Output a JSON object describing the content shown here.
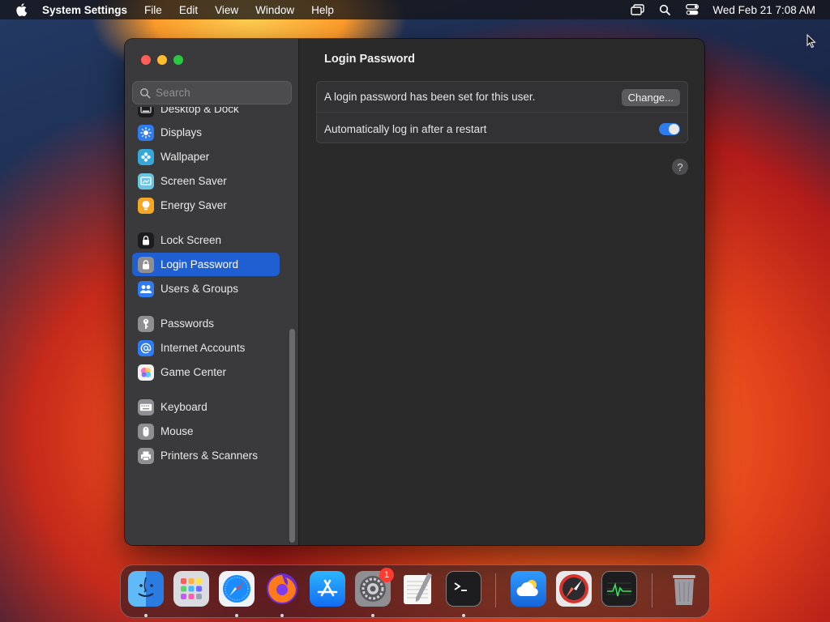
{
  "menubar": {
    "apple_icon": "apple-logo-icon",
    "app_name": "System Settings",
    "menus": [
      "File",
      "Edit",
      "View",
      "Window",
      "Help"
    ],
    "status_icons": [
      "screen-mirroring-icon",
      "spotlight-search-icon",
      "control-center-icon"
    ],
    "clock": "Wed Feb 21  7:08 AM"
  },
  "window": {
    "search": {
      "placeholder": "Search"
    },
    "sidebar": {
      "items": [
        {
          "label": "Desktop & Dock",
          "icon": "desktop-dock-icon",
          "color": "#2c2c2e"
        },
        {
          "label": "Displays",
          "icon": "displays-icon",
          "color": "#2f7bf0"
        },
        {
          "label": "Wallpaper",
          "icon": "wallpaper-icon",
          "color": "#35a8d8"
        },
        {
          "label": "Screen Saver",
          "icon": "screen-saver-icon",
          "color": "#6ac4e0"
        },
        {
          "label": "Energy Saver",
          "icon": "energy-saver-icon",
          "color": "#f5a623"
        },
        {
          "label": "Lock Screen",
          "icon": "lock-screen-icon",
          "color": "#1c1c1e"
        },
        {
          "label": "Login Password",
          "icon": "login-password-icon",
          "color": "#8e8e93",
          "selected": true
        },
        {
          "label": "Users & Groups",
          "icon": "users-groups-icon",
          "color": "#2f7bf0"
        },
        {
          "label": "Passwords",
          "icon": "passwords-icon",
          "color": "#8e8e93"
        },
        {
          "label": "Internet Accounts",
          "icon": "internet-accounts-icon",
          "color": "#2f7bf0"
        },
        {
          "label": "Game Center",
          "icon": "game-center-icon",
          "color": "#ffffff"
        },
        {
          "label": "Keyboard",
          "icon": "keyboard-icon",
          "color": "#8e8e93"
        },
        {
          "label": "Mouse",
          "icon": "mouse-icon",
          "color": "#8e8e93"
        },
        {
          "label": "Printers & Scanners",
          "icon": "printers-scanners-icon",
          "color": "#8e8e93"
        }
      ]
    },
    "content": {
      "title": "Login Password",
      "password_status": "A login password has been set for this user.",
      "change_button": "Change...",
      "auto_login_label": "Automatically log in after a restart",
      "auto_login_enabled": true,
      "help": "?"
    }
  },
  "dock": {
    "apps": [
      {
        "name": "Finder",
        "icon": "finder-icon",
        "running": true
      },
      {
        "name": "Launchpad",
        "icon": "launchpad-icon",
        "running": false
      },
      {
        "name": "Safari",
        "icon": "safari-icon",
        "running": true
      },
      {
        "name": "Firefox",
        "icon": "firefox-icon",
        "running": true
      },
      {
        "name": "App Store",
        "icon": "app-store-icon",
        "running": false
      },
      {
        "name": "System Settings",
        "icon": "system-settings-icon",
        "running": true,
        "badge": "1"
      },
      {
        "name": "TextEdit",
        "icon": "textedit-icon",
        "running": false
      },
      {
        "name": "Terminal",
        "icon": "terminal-icon",
        "running": true
      },
      {
        "name": "Weather",
        "icon": "weather-icon",
        "running": false
      },
      {
        "name": "Digital Color Meter",
        "icon": "compass-app-icon",
        "running": false
      },
      {
        "name": "Activity Monitor",
        "icon": "activity-monitor-icon",
        "running": false
      },
      {
        "name": "Trash",
        "icon": "trash-icon",
        "running": false
      }
    ]
  }
}
